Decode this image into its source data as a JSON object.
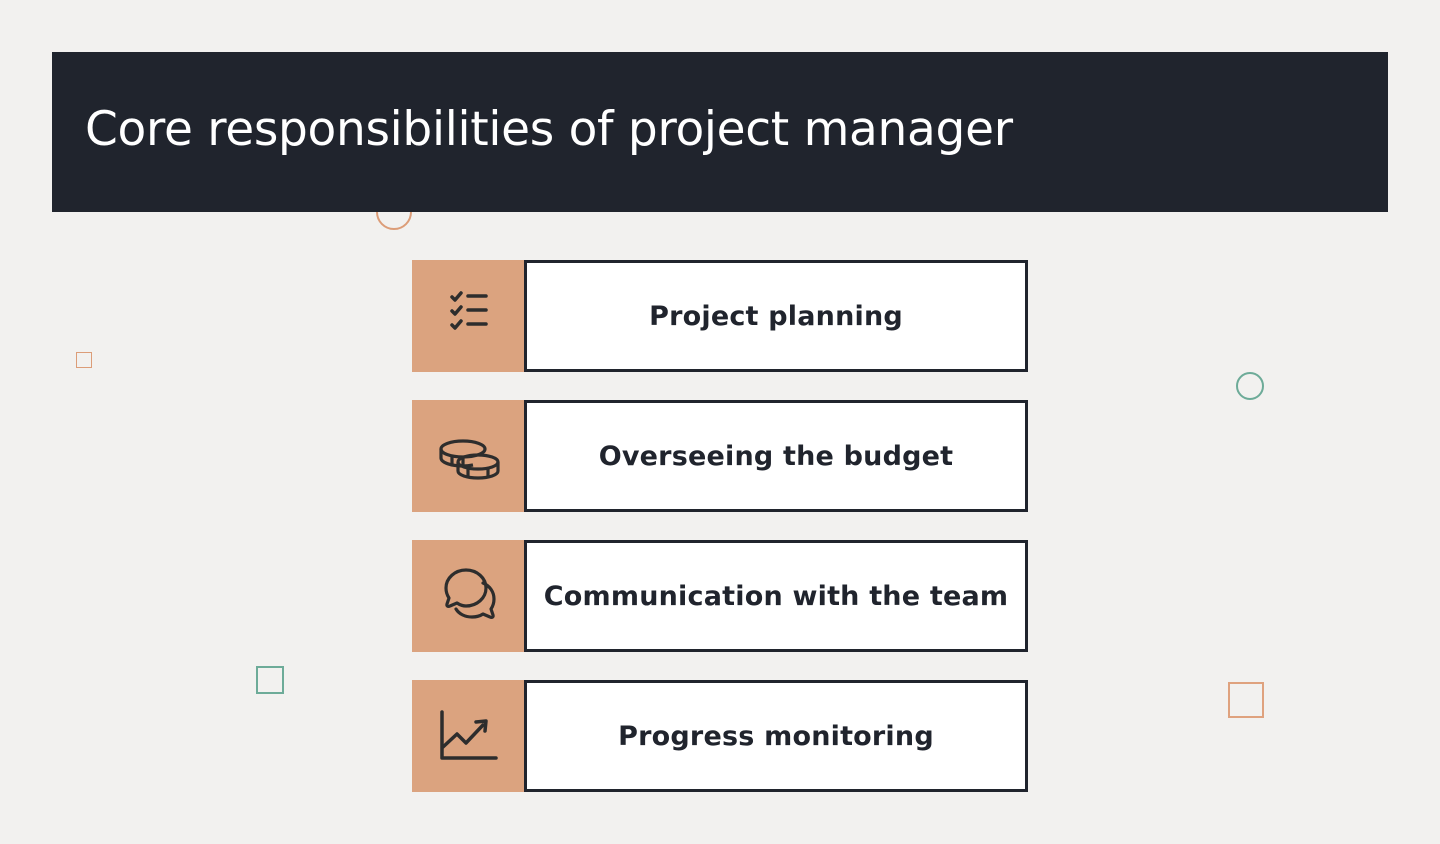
{
  "header": {
    "title": "Core responsibilities of project manager"
  },
  "colors": {
    "header_bg": "#20242d",
    "page_bg": "#f2f1ef",
    "icon_tile": "#dba37f",
    "accent_orange": "#dc9d78",
    "accent_green": "#6dab98",
    "text_dark": "#20242d"
  },
  "items": [
    {
      "label": "Project planning",
      "icon": "checklist-icon"
    },
    {
      "label": "Overseeing the budget",
      "icon": "coins-icon"
    },
    {
      "label": "Communication with the team",
      "icon": "chat-bubbles-icon"
    },
    {
      "label": "Progress monitoring",
      "icon": "trending-chart-icon"
    }
  ]
}
